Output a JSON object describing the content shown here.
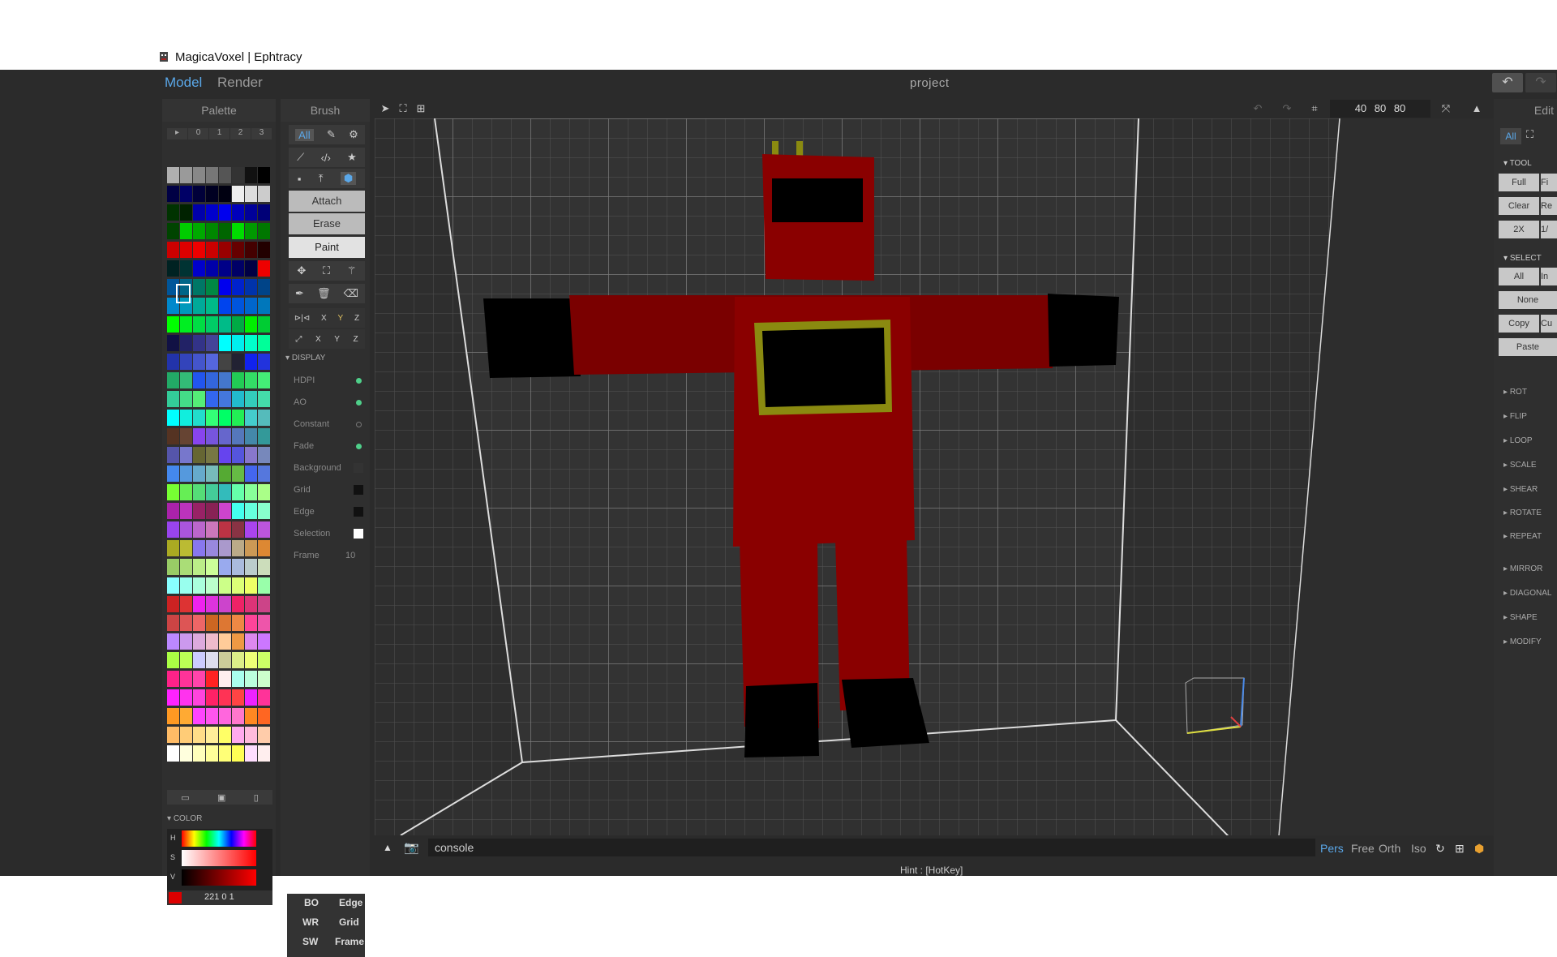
{
  "window": {
    "title": "MagicaVoxel | Ephtracy"
  },
  "tabs": [
    {
      "label": "Model"
    },
    {
      "label": "Render"
    }
  ],
  "project_name": "project",
  "palette": {
    "header": "Palette",
    "page_tabs": [
      "▸",
      "0",
      "1",
      "2",
      "3"
    ],
    "color_section": "COLOR",
    "color_labels": [
      "H",
      "S",
      "V"
    ],
    "color_value": "221  0  1",
    "colors": [
      "#b0b0b0",
      "#9a9a9a",
      "#888",
      "#777",
      "#555",
      "#333",
      "#111",
      "#000",
      "#000044",
      "#000066",
      "#00003a",
      "#000022",
      "#000011",
      "#eeeeee",
      "#dddddd",
      "#cccccc",
      "#003300",
      "#002200",
      "#0000aa",
      "#0000cc",
      "#0000ee",
      "#0000bb",
      "#000099",
      "#000077",
      "#004400",
      "#00cc00",
      "#00aa00",
      "#008800",
      "#006600",
      "#00dd00",
      "#009900",
      "#007700",
      "#cc0000",
      "#dd0000",
      "#ee0000",
      "#cc0000",
      "#990000",
      "#660000",
      "#440000",
      "#220000",
      "#002222",
      "#003333",
      "#0000cc",
      "#0000aa",
      "#000088",
      "#000066",
      "#000044",
      "#ee0000",
      "#005599",
      "#006688",
      "#007766",
      "#008844",
      "#0000ee",
      "#0022cc",
      "#0033aa",
      "#004488",
      "#0088cc",
      "#0099bb",
      "#00aa99",
      "#00bb88",
      "#0044ee",
      "#0055dd",
      "#0066cc",
      "#0077bb",
      "#00ff00",
      "#00ee22",
      "#00dd44",
      "#00cc66",
      "#00bb88",
      "#00aa44",
      "#00ee00",
      "#00cc33",
      "#111144",
      "#222266",
      "#333388",
      "#444499",
      "#00ffff",
      "#00eeee",
      "#00ffcc",
      "#00ff99",
      "#2233aa",
      "#3344bb",
      "#4455cc",
      "#5566dd",
      "#444444",
      "#222233",
      "#1122ee",
      "#2233dd",
      "#22aa66",
      "#33bb77",
      "#2255ee",
      "#3366dd",
      "#4477cc",
      "#22cc55",
      "#33dd66",
      "#44ee77",
      "#33cc99",
      "#44dd88",
      "#55ee77",
      "#3366ee",
      "#4477dd",
      "#22bbcc",
      "#33ccbb",
      "#44ddaa",
      "#00ffff",
      "#11eedd",
      "#22ddcc",
      "#33ff77",
      "#00ff66",
      "#22ee55",
      "#44cccc",
      "#55bbbb",
      "#553322",
      "#664433",
      "#8844ee",
      "#7755dd",
      "#6666cc",
      "#5577bb",
      "#4488aa",
      "#339999",
      "#5555aa",
      "#7777cc",
      "#666633",
      "#777744",
      "#6644ee",
      "#5555dd",
      "#8877cc",
      "#7788bb",
      "#4488ee",
      "#5599dd",
      "#66aacc",
      "#77bbbb",
      "#55aa33",
      "#66bb44",
      "#4466ee",
      "#5577dd",
      "#77ff33",
      "#66ee55",
      "#55dd77",
      "#44cc99",
      "#33bbbb",
      "#66ffaa",
      "#88ff99",
      "#aaff88",
      "#aa22aa",
      "#bb33bb",
      "#992266",
      "#882255",
      "#cc44cc",
      "#44ffee",
      "#66ffdd",
      "#88ffcc",
      "#9944ee",
      "#aa55dd",
      "#bb66cc",
      "#cc77bb",
      "#bb3344",
      "#883344",
      "#aa44ee",
      "#bb55dd",
      "#aaaa22",
      "#bbbb33",
      "#8877ee",
      "#9988dd",
      "#aa99cc",
      "#bbaa88",
      "#cc9955",
      "#dd8833",
      "#99cc66",
      "#aadd77",
      "#bbee88",
      "#ccff99",
      "#99aaee",
      "#aabbdd",
      "#bbcccc",
      "#ccddbb",
      "#88ffff",
      "#99ffee",
      "#aaffdd",
      "#bbffcc",
      "#ccff88",
      "#ddff77",
      "#eeff66",
      "#99ffaa",
      "#cc2222",
      "#dd3333",
      "#ee22ee",
      "#dd33dd",
      "#cc44cc",
      "#ee2266",
      "#dd3377",
      "#cc4488",
      "#cc4444",
      "#dd5555",
      "#ee6666",
      "#cc6622",
      "#dd7733",
      "#ee8844",
      "#ff4499",
      "#ee55aa",
      "#bb88ff",
      "#cc99ee",
      "#ddaadd",
      "#eebbcc",
      "#ffcc99",
      "#ee9944",
      "#dd88ee",
      "#cc77ff",
      "#aaff44",
      "#bbff55",
      "#ccccff",
      "#ddddee",
      "#cccc99",
      "#ddee88",
      "#eeff77",
      "#ccff66",
      "#ff2288",
      "#ff3399",
      "#ff44aa",
      "#ff2222",
      "#ffeeee",
      "#aaffee",
      "#bbffdd",
      "#ccffcc",
      "#ff22ff",
      "#ff33ee",
      "#ff44dd",
      "#ff2266",
      "#ff3355",
      "#ff4444",
      "#ee22ff",
      "#ff3399",
      "#ff9922",
      "#ffaa33",
      "#ff44ff",
      "#ff55ee",
      "#ff66dd",
      "#ff77cc",
      "#ff8822",
      "#ff6622",
      "#ffbb66",
      "#ffcc77",
      "#ffdd88",
      "#ffee99",
      "#ffff66",
      "#ffaaee",
      "#ffbbdd",
      "#ffccaa",
      "#ffffff",
      "#ffffdd",
      "#ffffbb",
      "#ffff99",
      "#ffff77",
      "#ffff55",
      "#ffddff",
      "#ffeeee"
    ]
  },
  "brush": {
    "header": "Brush",
    "filter_label": "All",
    "modes": [
      "Attach",
      "Erase",
      "Paint"
    ],
    "axes_row1": [
      "X",
      "Y",
      "Z"
    ],
    "axes_row2": [
      "X",
      "Y",
      "Z"
    ],
    "display_header": "DISPLAY",
    "display_items": [
      {
        "label": "HDPI"
      },
      {
        "label": "AO"
      },
      {
        "label": "Constant"
      },
      {
        "label": "Fade"
      },
      {
        "label": "Background"
      },
      {
        "label": "Grid"
      },
      {
        "label": "Edge"
      },
      {
        "label": "Selection"
      },
      {
        "label": "Frame",
        "value": "10"
      }
    ],
    "bottom_left": [
      "BO",
      "WR",
      "SW"
    ],
    "bottom_right": [
      "Edge",
      "Grid",
      "Frame"
    ]
  },
  "viewport": {
    "dims": "40  80  80",
    "console_placeholder": "console",
    "view_modes": [
      "Pers",
      "Free",
      "Orth",
      "Iso"
    ],
    "hint": "Hint : [HotKey]"
  },
  "edit": {
    "header": "Edit",
    "filter_label": "All",
    "tool_header": "TOOL",
    "tool_buttons": [
      "Full",
      "Clear",
      "2X"
    ],
    "tool_buttons_right": [
      "Fi",
      "Re",
      "1/"
    ],
    "select_header": "SELECT",
    "select_buttons": [
      "All",
      "None",
      "Copy",
      "Paste"
    ],
    "select_right": [
      "In",
      "Cu"
    ],
    "collapsed": [
      "ROT",
      "FLIP",
      "LOOP",
      "SCALE",
      "SHEAR",
      "ROTATE",
      "REPEAT",
      "MIRROR",
      "DIAGONAL",
      "SHAPE",
      "MODIFY"
    ]
  }
}
